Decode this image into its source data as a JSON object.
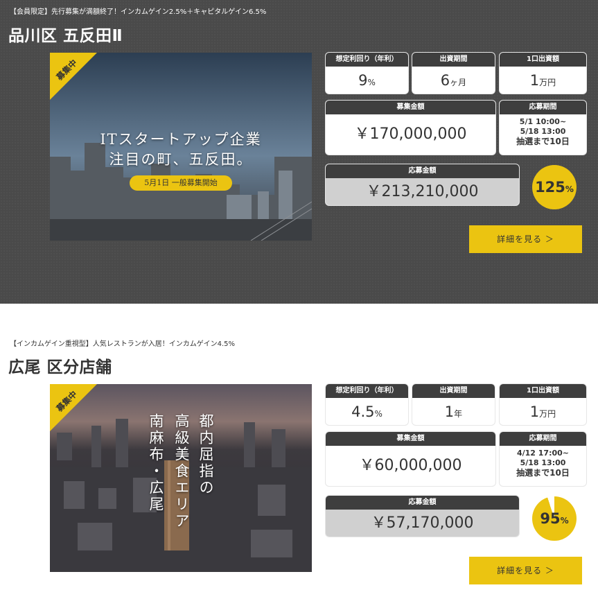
{
  "listings": [
    {
      "tagline": "【会員限定】先行募集が満額終了！インカムゲイン2.5%＋キャピタルゲイン6.5%",
      "title": "品川区 五反田Ⅱ",
      "ribbon": "募集中",
      "photo_headline": [
        "ITスタートアップ企業",
        "注目の町、五反田。"
      ],
      "photo_pill": "5月1日 一般募集開始",
      "yield": {
        "label": "想定利回り（年利）",
        "value": "9",
        "unit": "%"
      },
      "term": {
        "label": "出資期間",
        "value": "6",
        "unit": "ヶ月"
      },
      "unit_price": {
        "label": "1口出資額",
        "value": "1",
        "unit": "万円"
      },
      "raise_amount": {
        "label": "募集金額",
        "value": "￥170,000,000"
      },
      "app_period": {
        "label": "応募期間",
        "lines": [
          "5/1 10:00~",
          "5/18 13:00",
          "抽選まで10日"
        ]
      },
      "applied_amount": {
        "label": "応募金額",
        "value": "￥213,210,000"
      },
      "progress": {
        "percent": 125,
        "value": "125",
        "unit": "%"
      },
      "details_button": "詳細を見る ＞",
      "colors": {
        "ring": "#ebc411",
        "track": "#ffffff"
      }
    },
    {
      "tagline": "【インカムゲイン重視型】人気レストランが入居！インカムゲイン4.5%",
      "title": "広尾 区分店舗",
      "ribbon": "募集中",
      "photo_vertical": [
        "都内屈指の",
        "高級美食エリア",
        "南麻布・広尾"
      ],
      "yield": {
        "label": "想定利回り（年利）",
        "value": "4.5",
        "unit": "%"
      },
      "term": {
        "label": "出資期間",
        "value": "1",
        "unit": "年"
      },
      "unit_price": {
        "label": "1口出資額",
        "value": "1",
        "unit": "万円"
      },
      "raise_amount": {
        "label": "募集金額",
        "value": "￥60,000,000"
      },
      "app_period": {
        "label": "応募期間",
        "lines": [
          "4/12 17:00~",
          "5/18 13:00",
          "抽選まで10日"
        ]
      },
      "applied_amount": {
        "label": "応募金額",
        "value": "￥57,170,000"
      },
      "progress": {
        "percent": 95,
        "value": "95",
        "unit": "%"
      },
      "details_button": "詳細を見る ＞",
      "colors": {
        "ring": "#ebc411",
        "track": "#ffffff"
      }
    }
  ]
}
